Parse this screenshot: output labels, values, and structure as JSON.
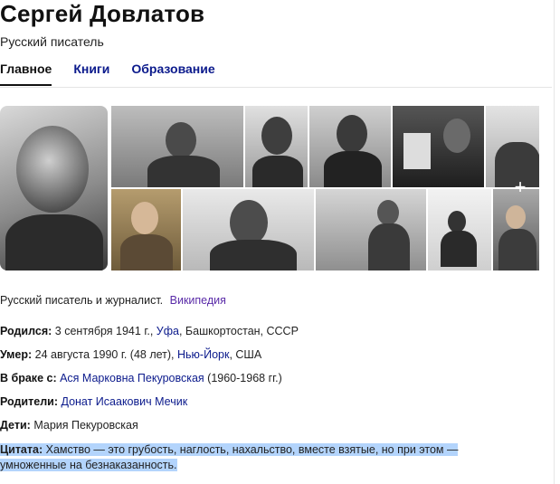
{
  "header": {
    "title": "Сергей Довлатов",
    "subtitle": "Русский писатель"
  },
  "tabs": [
    {
      "label": "Главное",
      "active": true
    },
    {
      "label": "Книги",
      "active": false
    },
    {
      "label": "Образование",
      "active": false
    }
  ],
  "gallery": {
    "expand_icon": "plus-icon"
  },
  "description": {
    "text": "Русский писатель и журналист.",
    "source_link": "Википедия"
  },
  "facts": {
    "born": {
      "label": "Родился:",
      "pre": "3 сентября 1941 г., ",
      "link": "Уфа",
      "post": ", Башкортостан, СССР"
    },
    "died": {
      "label": "Умер:",
      "pre": "24 августа 1990 г. (48 лет), ",
      "link": "Нью-Йорк",
      "post": ", США"
    },
    "married": {
      "label": "В браке с:",
      "link": "Ася Марковна Пекуровская",
      "post": " (1960-1968 гг.)"
    },
    "parents": {
      "label": "Родители:",
      "link": "Донат Исаакович Мечик"
    },
    "children": {
      "label": "Дети:",
      "text": "Мария Пекуровская"
    },
    "quote": {
      "label": "Цитата:",
      "text": "Хамство — это грубость, наглость, нахальство, вместе взятые, но при этом — умноженные на безнаказанность."
    }
  },
  "colors": {
    "link": "#0b1a8c",
    "wiki_link": "#5a2ba8",
    "selection": "#b3d4fc"
  }
}
